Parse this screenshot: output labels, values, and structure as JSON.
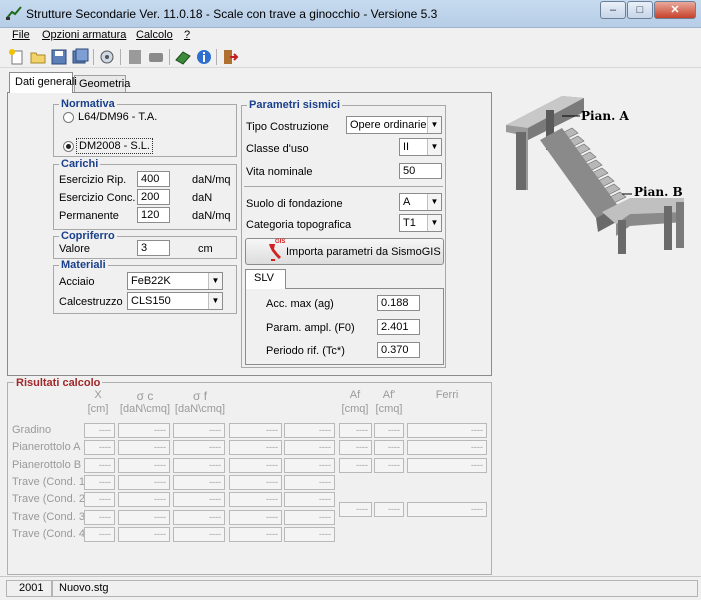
{
  "window": {
    "title": "Strutture Secondarie Ver. 11.0.18 - Scale con trave a ginocchio - Versione 5.3",
    "min": "–",
    "max": "□",
    "close": "✕"
  },
  "menu": [
    "File",
    "Opzioni armatura",
    "Calcolo",
    "?"
  ],
  "tabs": {
    "active": "Dati generali",
    "inactive": "Geometria"
  },
  "normativa": {
    "title": "Normativa",
    "opt1": "L64/DM96 - T.A.",
    "opt2": "DM2008 - S.L."
  },
  "carichi": {
    "title": "Carichi",
    "rows": [
      {
        "label": "Esercizio Rip.",
        "value": "400",
        "unit": "daN/mq"
      },
      {
        "label": "Esercizio Conc.",
        "value": "200",
        "unit": "daN"
      },
      {
        "label": "Permanente",
        "value": "120",
        "unit": "daN/mq"
      }
    ]
  },
  "copriferro": {
    "title": "Copriferro",
    "label": "Valore",
    "value": "3",
    "unit": "cm"
  },
  "materiali": {
    "title": "Materiali",
    "acciaio_label": "Acciaio",
    "acciaio": "FeB22K",
    "cls_label": "Calcestruzzo",
    "cls": "CLS150"
  },
  "sismici": {
    "title": "Parametri sismici",
    "tipo_label": "Tipo Costruzione",
    "tipo": "Opere ordinarie",
    "classe_label": "Classe d'uso",
    "classe": "II",
    "vita_label": "Vita nominale",
    "vita": "50",
    "suolo_label": "Suolo di fondazione",
    "suolo": "A",
    "cat_label": "Categoria topografica",
    "cat": "T1",
    "import_button": "Importa parametri da SismoGIS",
    "gis_badge": "GIS",
    "slv_tab": "SLV",
    "acc_label": "Acc. max (ag)",
    "acc": "0.188",
    "param_label": "Param. ampl.  (F0)",
    "param": "2.401",
    "periodo_label": "Periodo rif.  (Tc*)",
    "periodo": "0.370"
  },
  "figure": {
    "pianA": "Pian. A",
    "pianB": "Pian. B"
  },
  "risultati": {
    "title": "Risultati calcolo",
    "headers": [
      {
        "top": "X",
        "bottom": "[cm]"
      },
      {
        "top": "σ c",
        "bottom": "[daN\\cmq]"
      },
      {
        "top": "σ f",
        "bottom": "[daN\\cmq]"
      },
      {
        "top": "Af",
        "bottom": "[cmq]"
      },
      {
        "top": "Af'",
        "bottom": "[cmq]"
      },
      {
        "top": "Ferri",
        "bottom": ""
      }
    ],
    "rows": [
      "Gradino",
      "Pianerottolo A",
      "Pianerottolo B",
      "Trave (Cond. 1)",
      "Trave (Cond. 2)",
      "Trave (Cond. 3)",
      "Trave (Cond. 4)"
    ],
    "empty": "----"
  },
  "status": {
    "code": "2001",
    "file": "Nuovo.stg"
  },
  "colors": {
    "group_title": "#1a3f8c",
    "results_title": "#a0282a"
  }
}
